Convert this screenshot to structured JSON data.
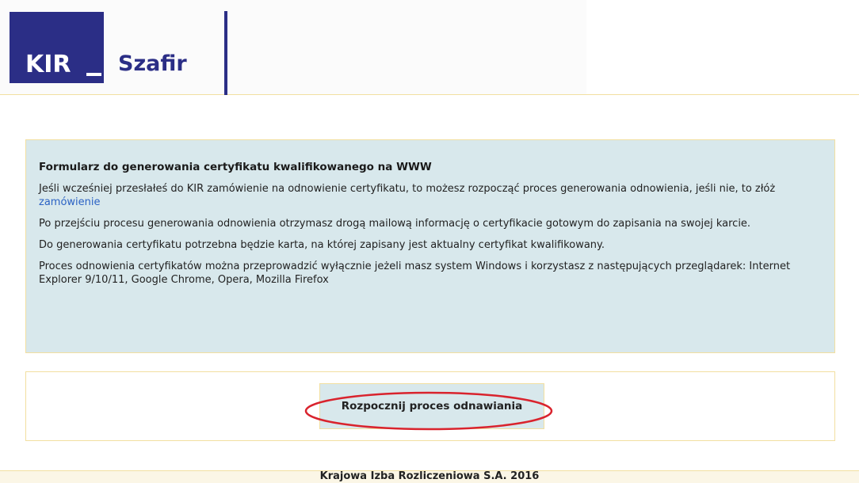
{
  "header": {
    "logo_text": "KIR",
    "brand_text": "Szafir"
  },
  "info": {
    "title": "Formularz do generowania certyfikatu kwalifikowanego na WWW",
    "p1_text": "Jeśli wcześniej przesłałeś do KIR zamówienie na odnowienie certyfikatu, to możesz rozpocząć proces generowania odnowienia, jeśli nie, to złóż ",
    "p1_link": "zamówienie",
    "p2": "Po przejściu procesu generowania odnowienia otrzymasz drogą mailową informację o certyfikacie gotowym do zapisania na swojej karcie.",
    "p3": "Do generowania certyfikatu potrzebna będzie karta, na której zapisany jest aktualny certyfikat kwalifikowany.",
    "p4": "Proces odnowienia certyfikatów można przeprowadzić wyłącznie jeżeli masz system Windows i korzystasz z następujących przeglądarek: Internet Explorer 9/10/11, Google Chrome, Opera, Mozilla Firefox"
  },
  "actions": {
    "start_label": "Rozpocznij proces odnawiania"
  },
  "footer": {
    "text": "Krajowa Izba Rozliczeniowa S.A. 2016"
  },
  "colors": {
    "brand": "#2b2e86",
    "panel": "#d8e8ec",
    "border": "#f2dfa0",
    "link": "#2b62c4",
    "highlight": "#d9232d"
  }
}
